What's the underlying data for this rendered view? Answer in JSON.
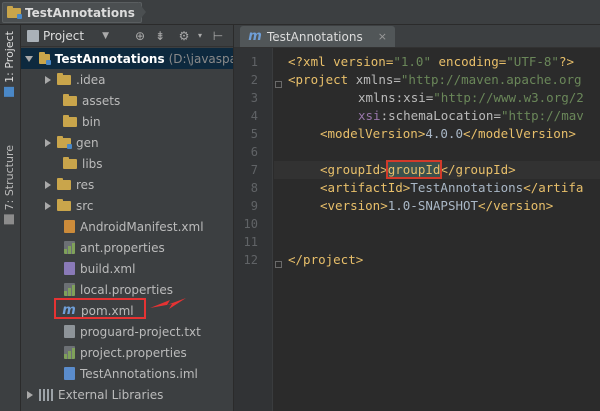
{
  "breadcrumb": {
    "label": "TestAnnotations"
  },
  "side_tabs": {
    "project": "1: Project",
    "structure": "7: Structure"
  },
  "panel": {
    "selector_label": "Project"
  },
  "tree": {
    "root_name": "TestAnnotations",
    "root_path": "(D:\\javaspa",
    "items": [
      ".idea",
      "assets",
      "bin",
      "gen",
      "libs",
      "res",
      "src",
      "AndroidManifest.xml",
      "ant.properties",
      "build.xml",
      "local.properties",
      "pom.xml",
      "proguard-project.txt",
      "project.properties",
      "TestAnnotations.iml"
    ],
    "external": "External Libraries"
  },
  "editor": {
    "tab_label": "TestAnnotations",
    "tab_close": "×",
    "line_numbers": [
      "1",
      "2",
      "3",
      "4",
      "5",
      "6",
      "7",
      "8",
      "9",
      "10",
      "11",
      "12"
    ],
    "lines": {
      "l1": [
        "<?xml version=",
        "\"1.0\"",
        " encoding=",
        "\"UTF-8\"",
        "?>"
      ],
      "l2": [
        "<project",
        " xmlns=",
        "\"http://maven.apache.org"
      ],
      "l3": [
        "xmlns",
        ":xsi",
        "=",
        "\"http://www.w3.org/2"
      ],
      "l4": [
        "xsi",
        ":schemaLocation",
        "=",
        "\"http://mav"
      ],
      "l5": [
        "<modelVersion>",
        "4.0.0",
        "</modelVersion>"
      ],
      "l7": [
        "<groupId>",
        "groupId",
        "</groupId>"
      ],
      "l8": [
        "<artifactId>",
        "TestAnnotations",
        "</artifa"
      ],
      "l9": [
        "<version>",
        "1.0-SNAPSHOT",
        "</version>"
      ],
      "l12": [
        "</project>"
      ]
    }
  }
}
